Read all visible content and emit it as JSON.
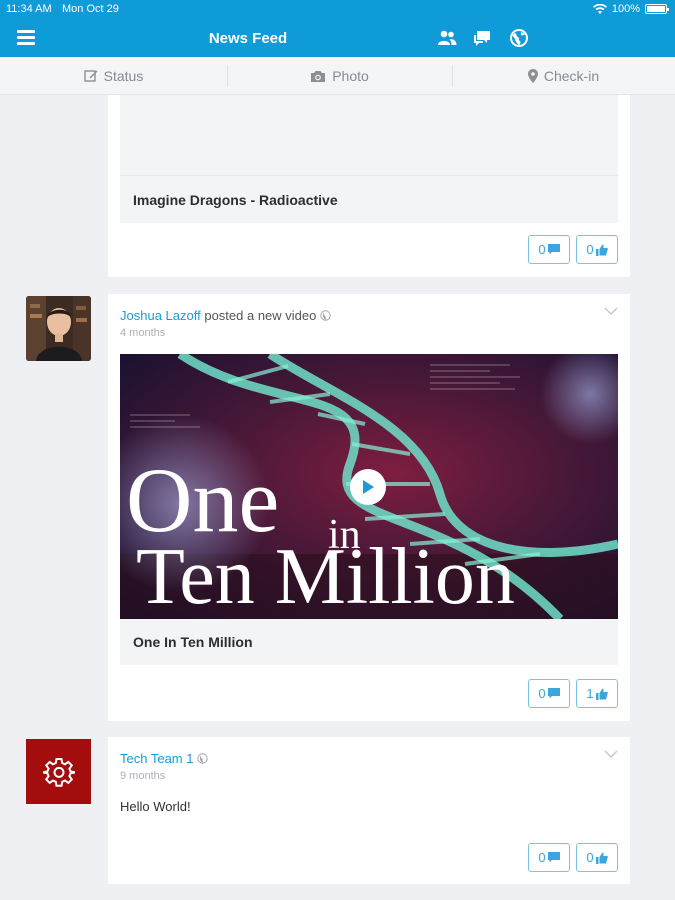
{
  "status_bar": {
    "time": "11:34 AM",
    "date": "Mon Oct 29",
    "battery": "100%",
    "battery_level": 1.0
  },
  "navbar": {
    "title": "News Feed",
    "icons": [
      "menu-icon",
      "friends-icon",
      "messages-icon",
      "globe-icon"
    ]
  },
  "actions": {
    "status": "Status",
    "photo": "Photo",
    "checkin": "Check-in"
  },
  "posts": [
    {
      "caption": "Imagine Dragons - Radioactive",
      "comments": "0",
      "likes": "0"
    },
    {
      "author": "Joshua Lazoff",
      "action": "posted a new video",
      "time": "4 months",
      "video_line1": "One",
      "video_line1b": "in",
      "video_line2": "Ten Million",
      "caption": "One In Ten Million",
      "comments": "0",
      "likes": "1"
    },
    {
      "author": "Tech Team 1",
      "time": "9 months",
      "text": "Hello World!",
      "comments": "0",
      "likes": "0"
    }
  ],
  "colors": {
    "brand": "#0f9bd7",
    "link": "#1a9bd7",
    "group_avatar": "#a40d0d"
  }
}
